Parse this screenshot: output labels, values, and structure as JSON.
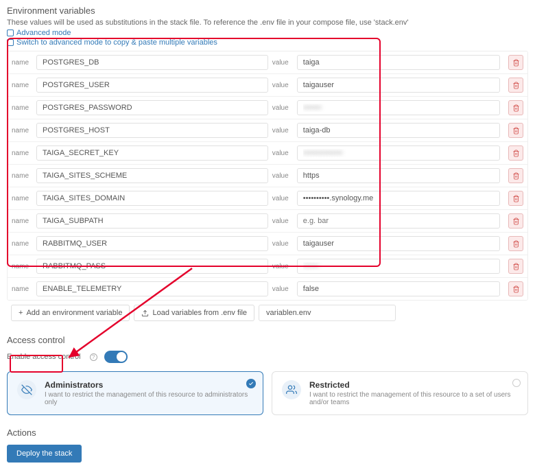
{
  "env": {
    "title": "Environment variables",
    "desc": "These values will be used as substitutions in the stack file. To reference the .env file in your compose file, use 'stack.env'",
    "advanced_link": "Advanced mode",
    "switch_link": "Switch to advanced mode to copy & paste multiple variables",
    "name_label": "name",
    "value_label": "value",
    "vars": [
      {
        "name": "POSTGRES_DB",
        "value": "taiga",
        "blur": false,
        "placeholder": ""
      },
      {
        "name": "POSTGRES_USER",
        "value": "taigauser",
        "blur": false,
        "placeholder": ""
      },
      {
        "name": "POSTGRES_PASSWORD",
        "value": "•••••••",
        "blur": true,
        "placeholder": ""
      },
      {
        "name": "POSTGRES_HOST",
        "value": "taiga-db",
        "blur": false,
        "placeholder": ""
      },
      {
        "name": "TAIGA_SECRET_KEY",
        "value": "•••••••••••••••",
        "blur": true,
        "placeholder": ""
      },
      {
        "name": "TAIGA_SITES_SCHEME",
        "value": "https",
        "blur": false,
        "placeholder": ""
      },
      {
        "name": "TAIGA_SITES_DOMAIN",
        "value": "••••••••••.synology.me",
        "blur": false,
        "placeholder": ""
      },
      {
        "name": "TAIGA_SUBPATH",
        "value": "",
        "blur": false,
        "placeholder": "e.g. bar"
      },
      {
        "name": "RABBITMQ_USER",
        "value": "taigauser",
        "blur": false,
        "placeholder": ""
      },
      {
        "name": "RABBITMQ_PASS",
        "value": "••••••",
        "blur": true,
        "placeholder": ""
      },
      {
        "name": "ENABLE_TELEMETRY",
        "value": "false",
        "blur": false,
        "placeholder": ""
      }
    ],
    "add_btn": "Add an environment variable",
    "load_btn": "Load variables from .env file",
    "file_name": "variablen.env"
  },
  "access": {
    "title": "Access control",
    "enable_label": "Enable access control",
    "cards": {
      "admin": {
        "title": "Administrators",
        "desc": "I want to restrict the management of this resource to administrators only"
      },
      "restricted": {
        "title": "Restricted",
        "desc": "I want to restrict the management of this resource to a set of users and/or teams"
      }
    }
  },
  "actions": {
    "title": "Actions",
    "deploy_btn": "Deploy the stack"
  }
}
